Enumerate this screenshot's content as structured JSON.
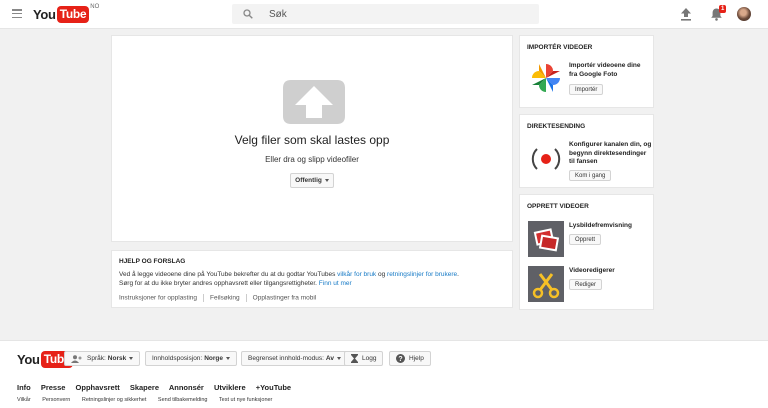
{
  "header": {
    "logo_you": "You",
    "logo_tube": "Tube",
    "logo_region": "NO",
    "search_placeholder": "Søk",
    "notification_count": "1"
  },
  "upload": {
    "title": "Velg filer som skal lastes opp",
    "subtitle": "Eller dra og slipp videofiler",
    "privacy_label": "Offentlig"
  },
  "help": {
    "title": "HJELP OG FORSLAG",
    "line1_prefix": "Ved å legge videoene dine på YouTube bekrefter du at du godtar YouTubes ",
    "line1_link1": "vilkår for bruk",
    "line1_mid": " og ",
    "line1_link2": "retningslinjer for brukere",
    "line1_suffix": ".",
    "line2_text": "Sørg for at du ikke bryter andres opphavsrett eller tilgangsrettigheter. ",
    "line2_link": "Finn ut mer",
    "links": [
      "Instruksjoner for opplasting",
      "Feilsøking",
      "Opplastinger fra mobil"
    ]
  },
  "import": {
    "title": "IMPORTÉR VIDEOER",
    "text_line1": "Importér videoene dine",
    "text_line2": "fra Google Foto",
    "button": "Importér"
  },
  "live": {
    "title": "DIREKTESENDING",
    "text_line1": "Konfigurer kanalen din, og",
    "text_line2": "begynn direktesendinger",
    "text_line3": "til fansen",
    "button": "Kom i gang"
  },
  "create": {
    "title": "OPPRETT VIDEOER",
    "slideshow_label": "Lysbildefremvisning",
    "slideshow_button": "Opprett",
    "editor_label": "Videoredigerer",
    "editor_button": "Rediger"
  },
  "footer": {
    "language_label": "Språk:",
    "language_value": "Norsk",
    "location_label": "Innholdsposisjon:",
    "location_value": "Norge",
    "restricted_label": "Begrenset innhold-modus:",
    "restricted_value": "Av",
    "history_label": "Logg",
    "help_label": "Hjelp",
    "nav": [
      "Info",
      "Presse",
      "Opphavsrett",
      "Skapere",
      "Annonsér",
      "Utviklere",
      "+YouTube"
    ],
    "sub": [
      "Vilkår",
      "Personvern",
      "Retningslinjer og sikkerhet",
      "Send tilbakemelding",
      "Test ut nye funksjoner"
    ]
  },
  "colors": {
    "brand_red": "#e62117",
    "link_blue": "#167ac6"
  },
  "icons": [
    "menu-icon",
    "search-icon",
    "upload-icon",
    "bell-icon",
    "cloud-upload-icon",
    "google-photos-icon",
    "live-broadcast-icon",
    "slideshow-icon",
    "scissors-icon",
    "user-icon",
    "hourglass-icon",
    "question-icon"
  ]
}
